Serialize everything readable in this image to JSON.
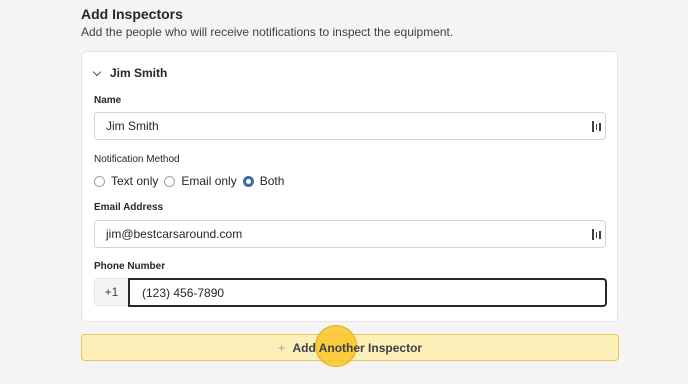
{
  "section": {
    "title": "Add Inspectors",
    "description": "Add the people who will receive notifications to inspect the equipment."
  },
  "inspector": {
    "header_name": "Jim Smith",
    "name_label": "Name",
    "name_value": "Jim Smith",
    "notification_label": "Notification Method",
    "notification_options": [
      "Text only",
      "Email only",
      "Both"
    ],
    "notification_selected": "Both",
    "email_label": "Email Address",
    "email_value": "jim@bestcarsaround.com",
    "phone_label": "Phone Number",
    "phone_prefix": "+1",
    "phone_value": "(123) 456-7890"
  },
  "actions": {
    "add_plus": "+",
    "add_label": "Add Another Inspector"
  },
  "colors": {
    "accent": "#3b6fa3",
    "button_bg": "#fcefb8",
    "click_marker": "#fac428"
  }
}
